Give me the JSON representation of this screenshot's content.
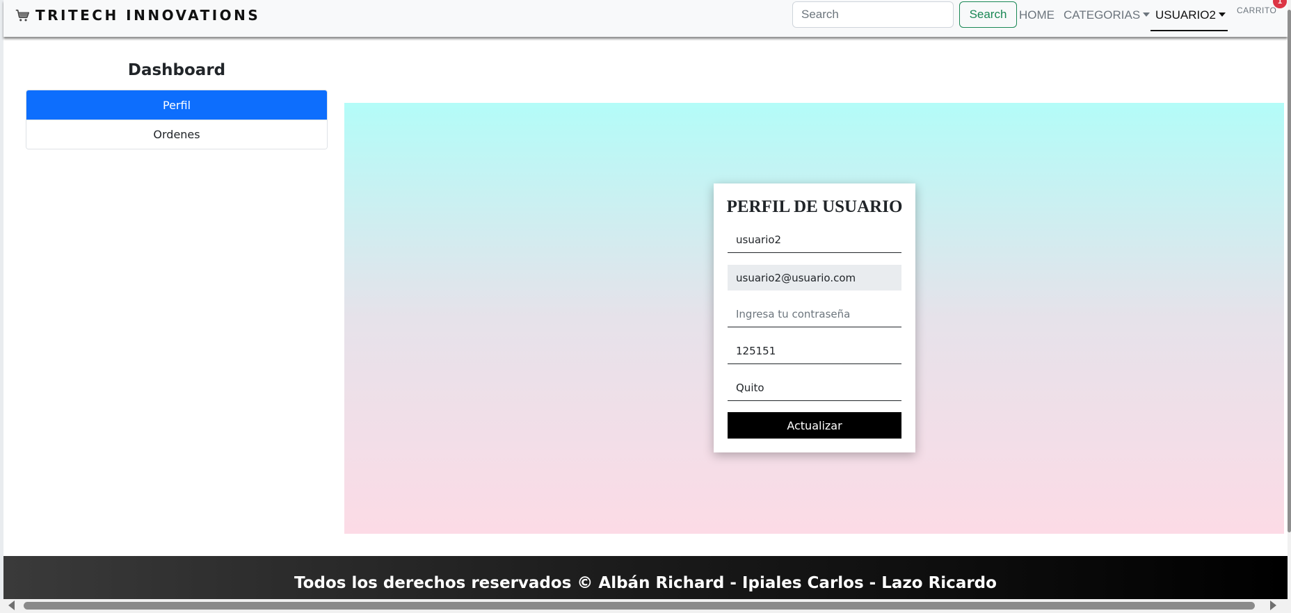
{
  "navbar": {
    "brand": "TRITECH INNOVATIONS",
    "brand_icon": "shopping-cart-icon",
    "search_placeholder": "Search",
    "search_button": "Search",
    "links": {
      "home": "HOME",
      "categorias": "CATEGORIAS",
      "usuario": "USUARIO2",
      "carrito": "CARRITO"
    },
    "cart_badge": "1"
  },
  "sidebar": {
    "title": "Dashboard",
    "items": [
      {
        "label": "Perfil",
        "active": true
      },
      {
        "label": "Ordenes",
        "active": false
      }
    ]
  },
  "profile": {
    "title": "PERFIL DE USUARIO",
    "username": "usuario2",
    "email": "usuario2@usuario.com",
    "password_placeholder": "Ingresa tu contraseña",
    "phone": "125151",
    "city": "Quito",
    "update_button": "Actualizar"
  },
  "footer": {
    "text": "Todos los derechos reservados © Albán Richard - Ipiales Carlos - Lazo Ricardo"
  },
  "colors": {
    "accent": "#0d6efd",
    "search_green": "#198754",
    "badge_red": "#dc3545",
    "gradient_top": "#b3fcf8",
    "gradient_bottom": "#fcdbe6"
  }
}
